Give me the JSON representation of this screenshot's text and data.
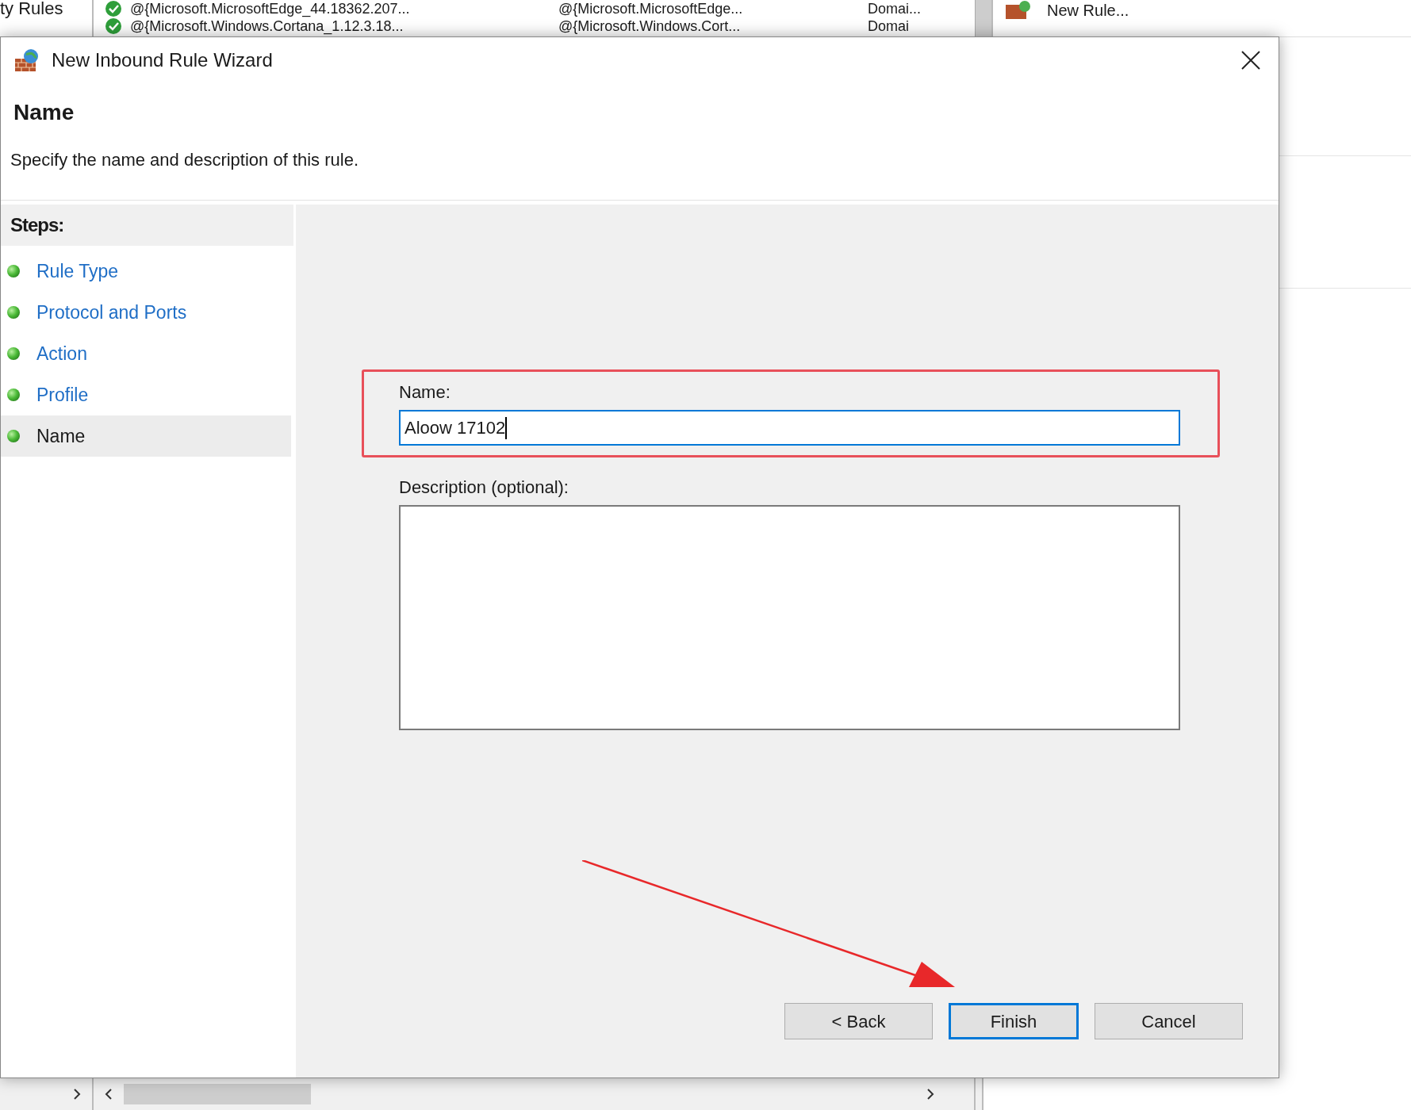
{
  "background_window": {
    "left_pane_label": "ty Rules",
    "rows": [
      {
        "name": "@{Microsoft.MicrosoftEdge_44.18362.207...",
        "group": "@{Microsoft.MicrosoftEdge...",
        "profile": "Domai..."
      },
      {
        "name": "@{Microsoft.Windows.Cortana_1.12.3.18...",
        "group": "@{Microsoft.Windows.Cort...",
        "profile": "Domai"
      }
    ],
    "actions": [
      "New Rule..."
    ]
  },
  "dialog": {
    "title": "New Inbound Rule Wizard",
    "heading": "Name",
    "subtitle": "Specify the name and description of this rule.",
    "steps_title": "Steps:",
    "steps": [
      {
        "label": "Rule Type",
        "selected": false
      },
      {
        "label": "Protocol and Ports",
        "selected": false
      },
      {
        "label": "Action",
        "selected": false
      },
      {
        "label": "Profile",
        "selected": false
      },
      {
        "label": "Name",
        "selected": true
      }
    ],
    "name_field": {
      "label": "Name:",
      "value": "Aloow 17102"
    },
    "description_field": {
      "label": "Description (optional):"
    },
    "buttons": [
      {
        "label": "< Back",
        "default": false
      },
      {
        "label": "Finish",
        "default": true
      },
      {
        "label": "Cancel",
        "default": false
      }
    ]
  }
}
